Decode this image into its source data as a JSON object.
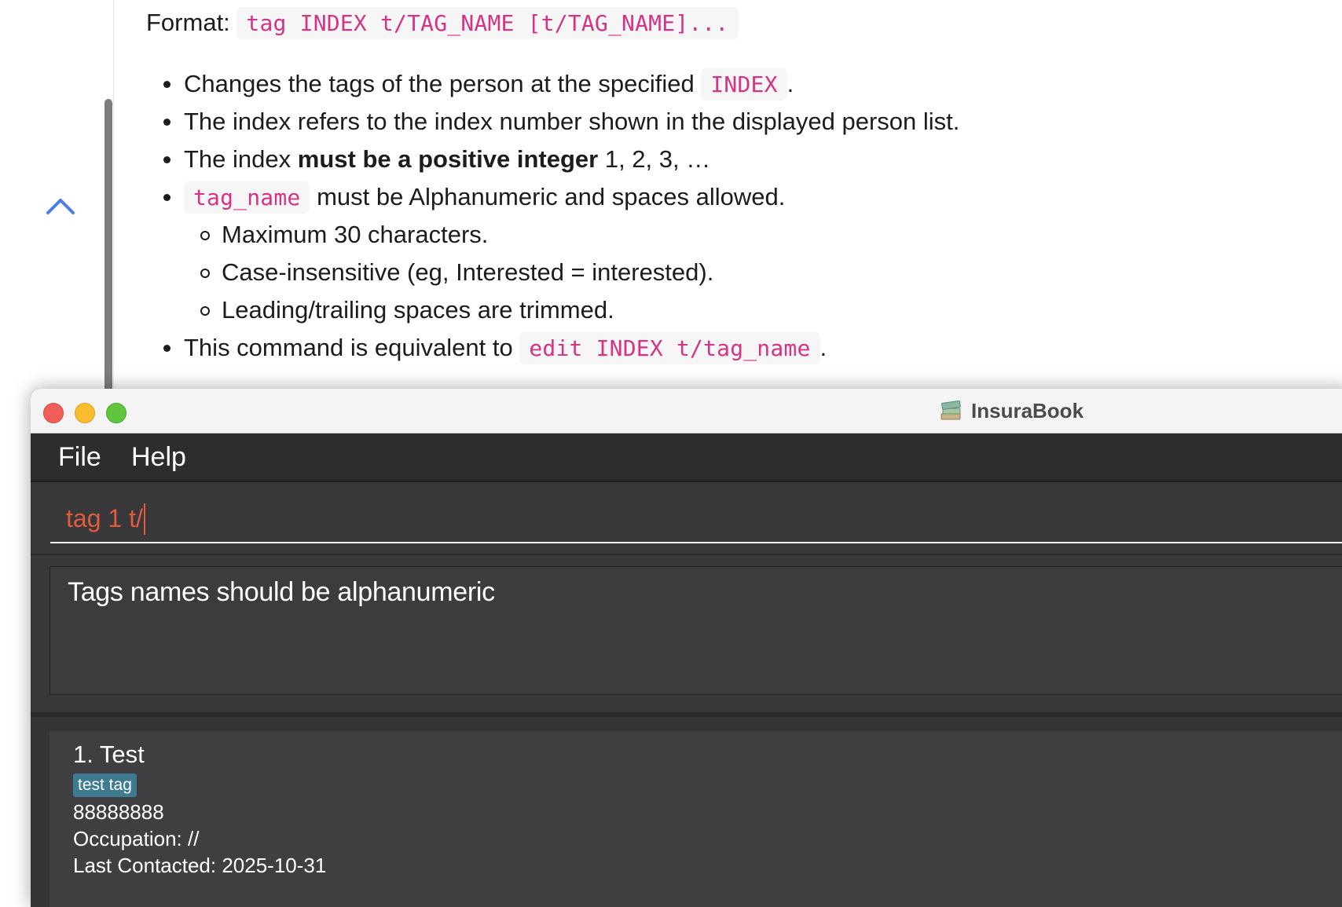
{
  "doc": {
    "format_label": "Format:",
    "format_code": "tag INDEX t/TAG_NAME [t/TAG_NAME]...",
    "bullet1_prefix": "Changes the tags of the person at the specified",
    "bullet1_code": "INDEX",
    "bullet1_suffix": ".",
    "bullet2": "The index refers to the index number shown in the displayed person list.",
    "bullet3_prefix": "The index",
    "bullet3_bold": "must be a positive integer",
    "bullet3_suffix": "1, 2, 3, …",
    "bullet4_code": "tag_name",
    "bullet4_suffix": "must be Alphanumeric and spaces allowed.",
    "sub1": "Maximum 30 characters.",
    "sub2": "Case-insensitive (eg, Interested = interested).",
    "sub3": "Leading/trailing spaces are trimmed.",
    "bullet5_prefix": "This command is equivalent to",
    "bullet5_code": "edit INDEX t/tag_name",
    "bullet5_suffix": ".",
    "back_to_top_icon": "chevron-up-icon"
  },
  "window": {
    "title": "InsuraBook",
    "app_icon": "books-icon",
    "traffic_lights": {
      "close": "#ef5f58",
      "minimize": "#f7bd2f",
      "maximize": "#5fc53d"
    }
  },
  "menu": {
    "file": "File",
    "help": "Help"
  },
  "command": {
    "value": "tag 1 t/"
  },
  "result": {
    "message": "Tags names should be alphanumeric"
  },
  "persons": [
    {
      "name": "1. Test",
      "tag": "test tag",
      "phone": "88888888",
      "occupation": "Occupation: //",
      "last_contacted": "Last Contacted: 2025-10-31"
    }
  ],
  "colors": {
    "code_text": "#d63384",
    "command_text": "#e05c3f",
    "tag_bg": "#3e7b91",
    "link_blue": "#4b7bec"
  }
}
